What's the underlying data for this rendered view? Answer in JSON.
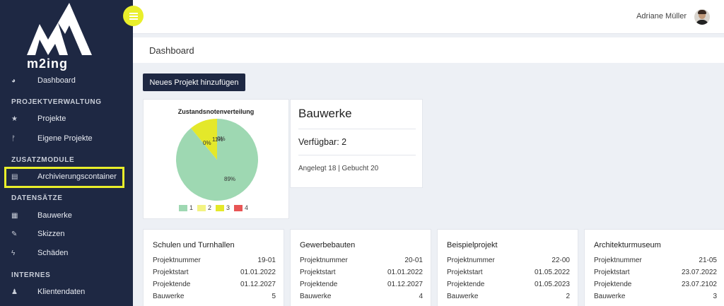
{
  "sidebar": {
    "logo_text": "m2ing",
    "items": {
      "dashboard": "Dashboard",
      "projekte": "Projekte",
      "eigene_projekte": "Eigene Projekte",
      "archivierungscontainer": "Archivierungscontainer",
      "bauwerke": "Bauwerke",
      "skizzen": "Skizzen",
      "schaeden": "Schäden",
      "klientendaten": "Klientendaten"
    },
    "sections": {
      "projektverwaltung": "PROJEKTVERWALTUNG",
      "zusatzmodule": "ZUSATZMODULE",
      "datensaetze": "DATENSÄTZE",
      "internes": "INTERNES"
    },
    "highlight_color": "#e9ef2a"
  },
  "topbar": {
    "user_name": "Adriane Müller"
  },
  "page": {
    "title": "Dashboard",
    "add_button": "Neues Projekt hinzufügen"
  },
  "chart_data": {
    "type": "pie",
    "title": "Zustandsnotenverteilung",
    "categories": [
      "1",
      "2",
      "3",
      "4"
    ],
    "values": [
      89,
      0,
      11,
      0
    ],
    "labels": [
      "89%",
      "0%",
      "11%",
      "0%"
    ],
    "colors": [
      "#9ed8b2",
      "#f3f383",
      "#e4e82a",
      "#e85555"
    ],
    "legend": "bottom"
  },
  "bauwerke": {
    "title": "Bauwerke",
    "available": "Verfügbar: 2",
    "stats": "Angelegt 18 | Gebucht 20"
  },
  "row_labels": {
    "nummer": "Projektnummer",
    "start": "Projektstart",
    "ende": "Projektende",
    "bauwerke": "Bauwerke"
  },
  "projects": [
    {
      "name": "Schulen und Turnhallen",
      "nummer": "19-01",
      "start": "01.01.2022",
      "ende": "01.12.2027",
      "bauwerke": "5"
    },
    {
      "name": "Gewerbebauten",
      "nummer": "20-01",
      "start": "01.01.2022",
      "ende": "01.12.2027",
      "bauwerke": "4"
    },
    {
      "name": "Beispielprojekt",
      "nummer": "22-00",
      "start": "01.05.2022",
      "ende": "01.05.2023",
      "bauwerke": "2"
    },
    {
      "name": "Architekturmuseum",
      "nummer": "21-05",
      "start": "23.07.2022",
      "ende": "23.07.2102",
      "bauwerke": "3"
    }
  ]
}
